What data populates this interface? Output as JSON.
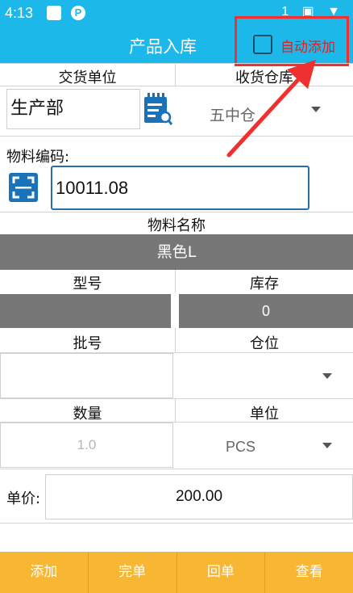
{
  "status": {
    "time": "4:13",
    "p_icon": "P",
    "right_icons": "1 ▣ ▼"
  },
  "title_bar": {
    "title": "产品入库",
    "auto_add_label": "自动添加"
  },
  "delivery": {
    "delivery_unit_label": "交货单位",
    "receiving_warehouse_label": "收货仓库",
    "delivery_unit_value": "生产部",
    "warehouse_value": "五中仓"
  },
  "material": {
    "code_label": "物料编码:",
    "code_value": "10011.08",
    "name_label": "物料名称",
    "name_value": "黑色L"
  },
  "model_stock": {
    "model_label": "型号",
    "stock_label": "库存",
    "model_value": "",
    "stock_value": "0"
  },
  "batch_location": {
    "batch_label": "批号",
    "location_label": "仓位",
    "batch_value": "",
    "location_value": ""
  },
  "qty_unit": {
    "qty_label": "数量",
    "unit_label": "单位",
    "qty_placeholder": "1.0",
    "unit_value": "PCS"
  },
  "price": {
    "label": "单价:",
    "value": "200.00"
  },
  "bottom_buttons": [
    {
      "label": "添加"
    },
    {
      "label": "完单"
    },
    {
      "label": "回单"
    },
    {
      "label": "查看"
    }
  ],
  "colors": {
    "accent": "#1cb8e9",
    "bottom_bar": "#f7b733",
    "highlight": "#ee3030"
  }
}
